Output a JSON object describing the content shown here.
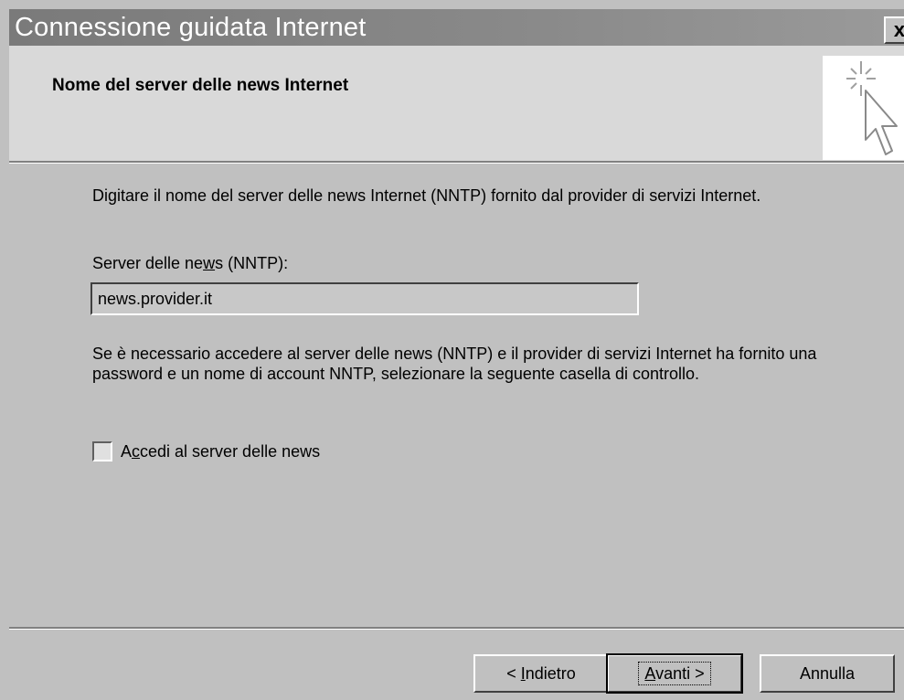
{
  "window": {
    "title": "Connessione guidata Internet",
    "close_label": "x"
  },
  "header": {
    "title": "Nome del server delle news Internet",
    "icon": "wizard-cursor-icon"
  },
  "content": {
    "description": "Digitare il nome del server delle news Internet (NNTP) fornito dal provider di servizi Internet.",
    "field_label_pre": "Server delle ne",
    "field_label_mnemonic": "w",
    "field_label_post": "s (NNTP):",
    "field_value": "news.provider.it",
    "note": "Se è necessario accedere al server delle news (NNTP) e il provider di servizi Internet ha fornito una password e un nome di account NNTP, selezionare la seguente casella di controllo.",
    "checkbox_checked": false,
    "checkbox_label_pre": "A",
    "checkbox_label_mnemonic": "c",
    "checkbox_label_post": "cedi al server delle news"
  },
  "buttons": {
    "back_pre": "< ",
    "back_mnemonic": "I",
    "back_post": "ndietro",
    "next_mnemonic": "A",
    "next_post": "vanti >",
    "cancel": "Annulla"
  },
  "colors": {
    "face": "#c0c0c0",
    "header_bg": "#d9d9d9",
    "titlebar": "#808080"
  }
}
